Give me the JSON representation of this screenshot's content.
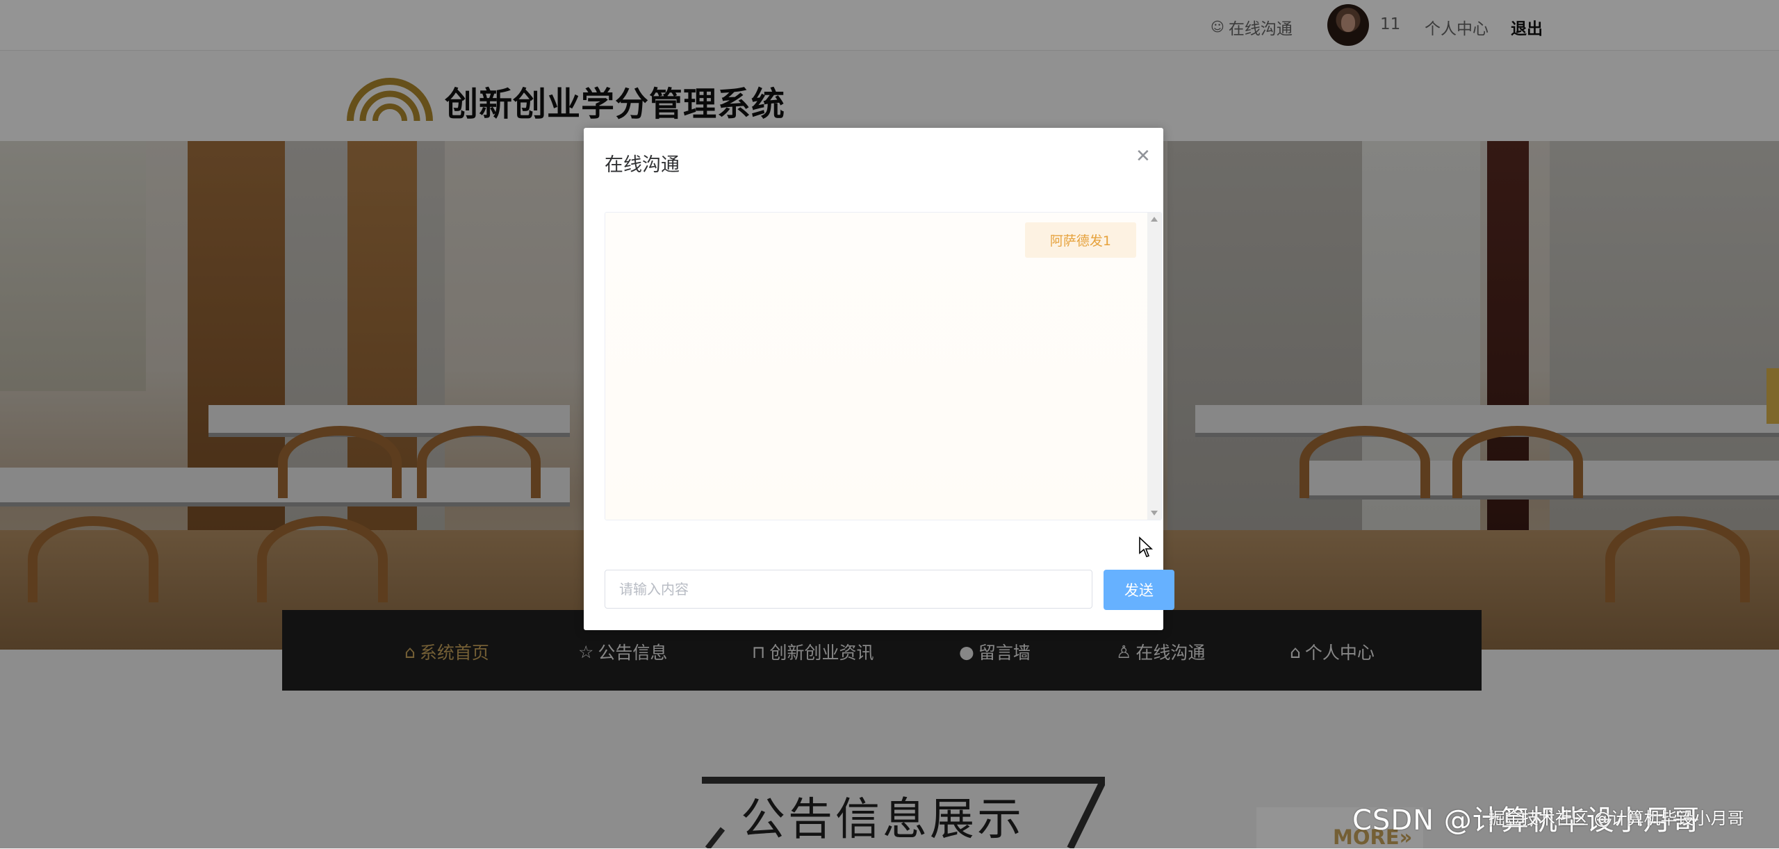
{
  "topbar": {
    "chat_link": "在线沟通",
    "username": "11",
    "profile": "个人中心",
    "logout": "退出"
  },
  "site": {
    "title": "创新创业学分管理系统"
  },
  "nav": {
    "items": [
      {
        "label": "系统首页",
        "icon": "home-icon",
        "active": true
      },
      {
        "label": "公告信息",
        "icon": "star-icon",
        "active": false
      },
      {
        "label": "创新创业资讯",
        "icon": "bag-icon",
        "active": false
      },
      {
        "label": "留言墙",
        "icon": "info-icon",
        "active": false
      },
      {
        "label": "在线沟通",
        "icon": "user-icon",
        "active": false
      },
      {
        "label": "个人中心",
        "icon": "home-icon",
        "active": false
      }
    ]
  },
  "section": {
    "title": "公告信息展示",
    "more": "MORE"
  },
  "modal": {
    "title": "在线沟通",
    "messages": [
      {
        "text": "阿萨德发1",
        "side": "right"
      }
    ],
    "input_placeholder": "请输入内容",
    "input_value": "",
    "send_label": "发送"
  },
  "watermark": {
    "large": "CSDN @计算机毕设小月哥",
    "small": "掘金技术社区 @计算机毕设小月哥"
  },
  "colors": {
    "accent": "#c9a45c",
    "primary": "#66b1ff",
    "bubble_bg": "#fdf2e2",
    "bubble_text": "#e6a23c"
  }
}
